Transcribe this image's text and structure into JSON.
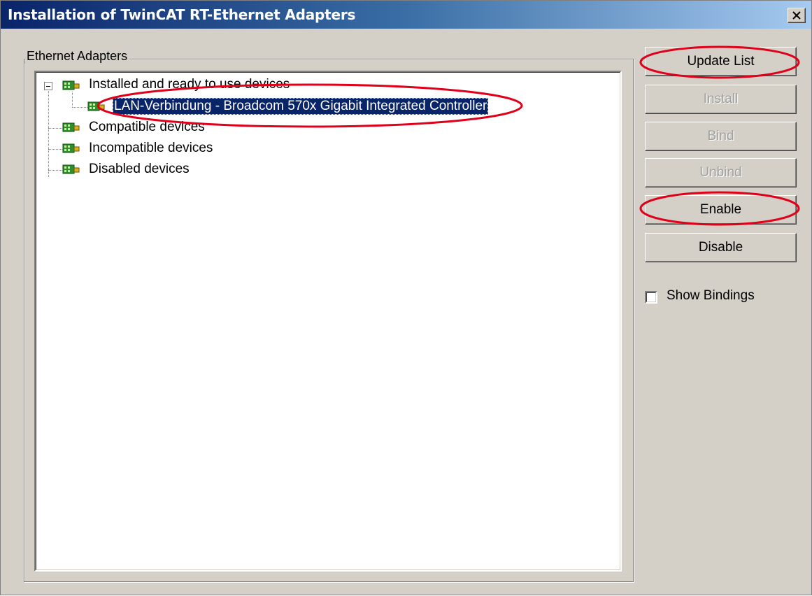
{
  "window": {
    "title": "Installation of TwinCAT RT-Ethernet Adapters",
    "close_symbol": "×"
  },
  "group": {
    "label": "Ethernet Adapters"
  },
  "tree": {
    "nodes": [
      {
        "label": "Installed and ready to use devices",
        "icon": "network-adapter-icon",
        "expanded": true
      },
      {
        "label": "LAN-Verbindung - Broadcom 570x Gigabit Integrated Controller",
        "icon": "network-adapter-icon",
        "selected": true
      },
      {
        "label": "Compatible devices",
        "icon": "network-adapter-icon"
      },
      {
        "label": "Incompatible devices",
        "icon": "network-adapter-icon"
      },
      {
        "label": "Disabled devices",
        "icon": "network-adapter-icon"
      }
    ]
  },
  "buttons": {
    "update_list": "Update List",
    "install": "Install",
    "bind": "Bind",
    "unbind": "Unbind",
    "enable": "Enable",
    "disable": "Disable"
  },
  "options": {
    "show_bindings_label": "Show Bindings",
    "show_bindings_checked": false
  },
  "colors": {
    "titlebar_start": "#0a246a",
    "titlebar_end": "#a6caf0",
    "selection": "#0a246a",
    "annotation": "#e0001a",
    "dialog_face": "#d4d0c8"
  }
}
